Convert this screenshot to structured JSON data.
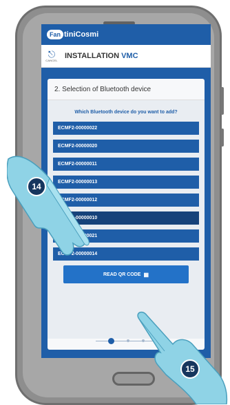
{
  "app": {
    "logo_badge": "Fan",
    "logo_rest": "tiniCosmi",
    "cancel_label": "CANCEL",
    "title_main": "INSTALLATION ",
    "title_accent": "VMC"
  },
  "step": {
    "title": "2. Selection of Bluetooth device",
    "question": "Which Bluetooth device do you want to add?",
    "devices": [
      "ECMF2-00000022",
      "ECMF2-00000020",
      "ECMF2-00000011",
      "ECMF2-00000013",
      "ECMF2-00000012",
      "ECMF2-00000010",
      "ECMF2-00000021",
      "ECMF2-00000014"
    ],
    "qr_button": "READ QR CODE",
    "qr_icon": "qr-code-icon"
  },
  "annotations": {
    "badge_1": "14",
    "badge_2": "15"
  },
  "colors": {
    "brand_blue": "#1f5ea8",
    "selected_row": "#16427a",
    "hand_skin": "#8fd3e6",
    "badge_bg": "#16365e"
  }
}
